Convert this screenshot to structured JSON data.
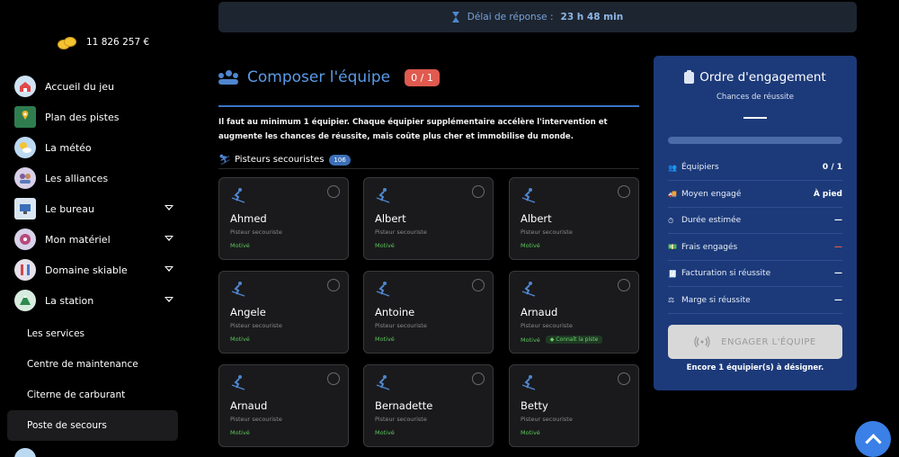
{
  "sidebar": {
    "money": "11 826 257 €",
    "items": [
      {
        "label": "Accueil du jeu",
        "icon": "home-icon"
      },
      {
        "label": "Plan des pistes",
        "icon": "map-icon"
      },
      {
        "label": "La météo",
        "icon": "weather-icon"
      },
      {
        "label": "Les alliances",
        "icon": "alliance-icon"
      },
      {
        "label": "Le bureau",
        "icon": "office-icon"
      },
      {
        "label": "Mon matériel",
        "icon": "equipment-icon"
      },
      {
        "label": "Domaine skiable",
        "icon": "ski-area-icon"
      },
      {
        "label": "La station",
        "icon": "station-icon"
      }
    ],
    "subitems": [
      {
        "label": "Les services"
      },
      {
        "label": "Centre de maintenance"
      },
      {
        "label": "Citerne de carburant"
      },
      {
        "label": "Poste de secours"
      }
    ]
  },
  "banner": {
    "label": "Délai de réponse :",
    "value": "23 h 48 min"
  },
  "section": {
    "title": "Composer l'équipe",
    "count": "0 / 1",
    "description": "Il faut au minimum 1 équipier. Chaque équipier supplémentaire accélère l'intervention et augmente les chances de réussite, mais coûte plus cher et immobilise du monde.",
    "subheader": "Pisteurs secouristes",
    "subheader_count": "106"
  },
  "cards": [
    {
      "name": "Ahmed",
      "role": "Pisteur secouriste",
      "status": "Motivé",
      "tag": ""
    },
    {
      "name": "Albert",
      "role": "Pisteur secouriste",
      "status": "Motivé",
      "tag": ""
    },
    {
      "name": "Albert",
      "role": "Pisteur secouriste",
      "status": "Motivé",
      "tag": ""
    },
    {
      "name": "Angele",
      "role": "Pisteur secouriste",
      "status": "Motivé",
      "tag": ""
    },
    {
      "name": "Antoine",
      "role": "Pisteur secouriste",
      "status": "Motivé",
      "tag": ""
    },
    {
      "name": "Arnaud",
      "role": "Pisteur secouriste",
      "status": "Motivé",
      "tag": "Connaît la piste"
    },
    {
      "name": "Arnaud",
      "role": "Pisteur secouriste",
      "status": "Motivé",
      "tag": ""
    },
    {
      "name": "Bernadette",
      "role": "Pisteur secouriste",
      "status": "Motivé",
      "tag": ""
    },
    {
      "name": "Betty",
      "role": "Pisteur secouriste",
      "status": "Motivé",
      "tag": ""
    }
  ],
  "panel": {
    "title": "Ordre d'engagement",
    "subtitle": "Chances de réussite",
    "success_chance": "—",
    "progress": 0,
    "rows": [
      {
        "label": "Équipiers",
        "value": "0 / 1",
        "icon": "team-icon",
        "red": false
      },
      {
        "label": "Moyen engagé",
        "value": "À pied",
        "icon": "truck-icon",
        "red": false
      },
      {
        "label": "Durée estimée",
        "value": "—",
        "icon": "stopwatch-icon",
        "red": false
      },
      {
        "label": "Frais engagés",
        "value": "—",
        "icon": "money-icon",
        "red": true
      },
      {
        "label": "Facturation si réussite",
        "value": "—",
        "icon": "invoice-icon",
        "red": false
      },
      {
        "label": "Marge si réussite",
        "value": "—",
        "icon": "scale-icon",
        "red": false
      }
    ],
    "button": "ENGAGER L'ÉQUIPE",
    "footer": "Encore 1 équipier(s) à désigner."
  },
  "colors": {
    "accent": "#4f86cf",
    "panel": "#1c3a7a",
    "danger": "#e05a4f",
    "success": "#5cc45c"
  }
}
